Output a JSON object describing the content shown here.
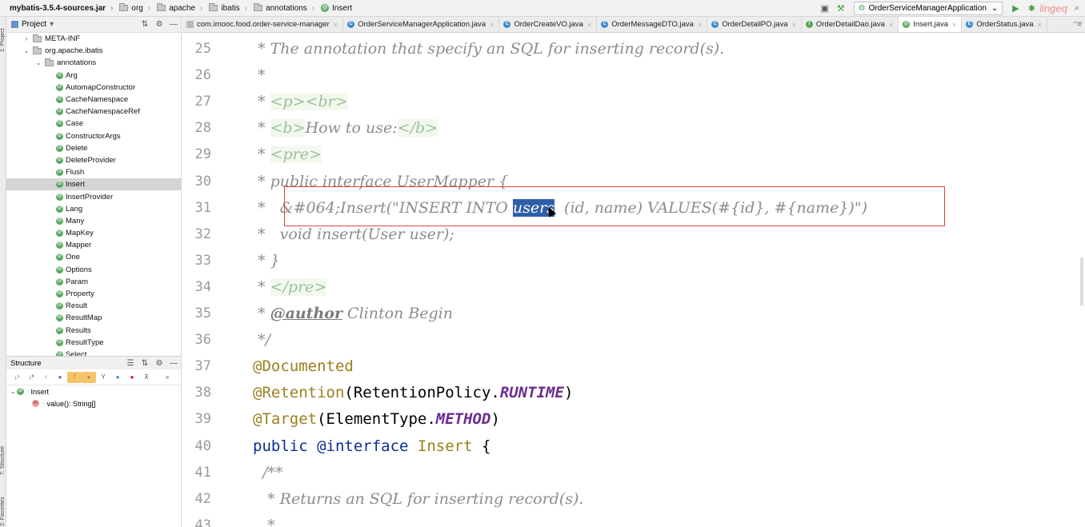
{
  "navbar": {
    "breadcrumbs": [
      {
        "label": "mybatis-3.5.4-sources.jar",
        "icon": "jar-icon"
      },
      {
        "label": "org",
        "icon": "folder-icon"
      },
      {
        "label": "apache",
        "icon": "folder-icon"
      },
      {
        "label": "ibatis",
        "icon": "folder-icon"
      },
      {
        "label": "annotations",
        "icon": "folder-icon"
      },
      {
        "label": "Insert",
        "icon": "annotation-icon"
      }
    ],
    "run_config": "OrderServiceManagerApplication",
    "watermark": "lingeq"
  },
  "project_panel": {
    "title": "Project",
    "tree": [
      {
        "label": "META-INF",
        "indent": 2,
        "arrow": "›",
        "type": "folder"
      },
      {
        "label": "org.apache.ibatis",
        "indent": 2,
        "arrow": "⌄",
        "type": "folder"
      },
      {
        "label": "annotations",
        "indent": 3,
        "arrow": "⌄",
        "type": "folder"
      },
      {
        "label": "Arg",
        "indent": 4,
        "type": "annotation"
      },
      {
        "label": "AutomapConstructor",
        "indent": 4,
        "type": "annotation"
      },
      {
        "label": "CacheNamespace",
        "indent": 4,
        "type": "annotation"
      },
      {
        "label": "CacheNamespaceRef",
        "indent": 4,
        "type": "annotation"
      },
      {
        "label": "Case",
        "indent": 4,
        "type": "annotation"
      },
      {
        "label": "ConstructorArgs",
        "indent": 4,
        "type": "annotation"
      },
      {
        "label": "Delete",
        "indent": 4,
        "type": "annotation"
      },
      {
        "label": "DeleteProvider",
        "indent": 4,
        "type": "annotation"
      },
      {
        "label": "Flush",
        "indent": 4,
        "type": "annotation"
      },
      {
        "label": "Insert",
        "indent": 4,
        "type": "annotation",
        "selected": true
      },
      {
        "label": "InsertProvider",
        "indent": 4,
        "type": "annotation"
      },
      {
        "label": "Lang",
        "indent": 4,
        "type": "annotation"
      },
      {
        "label": "Many",
        "indent": 4,
        "type": "annotation"
      },
      {
        "label": "MapKey",
        "indent": 4,
        "type": "annotation"
      },
      {
        "label": "Mapper",
        "indent": 4,
        "type": "annotation"
      },
      {
        "label": "One",
        "indent": 4,
        "type": "annotation"
      },
      {
        "label": "Options",
        "indent": 4,
        "type": "annotation"
      },
      {
        "label": "Param",
        "indent": 4,
        "type": "annotation"
      },
      {
        "label": "Property",
        "indent": 4,
        "type": "annotation"
      },
      {
        "label": "Result",
        "indent": 4,
        "type": "annotation"
      },
      {
        "label": "ResultMap",
        "indent": 4,
        "type": "annotation"
      },
      {
        "label": "Results",
        "indent": 4,
        "type": "annotation"
      },
      {
        "label": "ResultType",
        "indent": 4,
        "type": "annotation"
      },
      {
        "label": "Select",
        "indent": 4,
        "type": "annotation"
      }
    ]
  },
  "structure_panel": {
    "title": "Structure",
    "items": [
      {
        "label": "Insert",
        "kind": "annotation",
        "arrow": "⌄"
      },
      {
        "label": "value(): String[]",
        "kind": "method"
      }
    ]
  },
  "left_strip": {
    "labels": [
      "1: Project",
      "7: Structure",
      "2: Favorites"
    ]
  },
  "tabs": [
    {
      "label": "com.imooc.food.order-service-manager",
      "icon": "pkg"
    },
    {
      "label": "OrderServiceManagerApplication.java",
      "icon": "c"
    },
    {
      "label": "OrderCreateVO.java",
      "icon": "c"
    },
    {
      "label": "OrderMessageDTO.java",
      "icon": "c"
    },
    {
      "label": "OrderDetailPO.java",
      "icon": "c"
    },
    {
      "label": "OrderDetailDao.java",
      "icon": "i"
    },
    {
      "label": "Insert.java",
      "icon": "a",
      "active": true
    },
    {
      "label": "OrderStatus.java",
      "icon": "e"
    }
  ],
  "editor": {
    "lines": [
      {
        "n": "25",
        "html_parts": [
          {
            "t": " * The annotation that specify an SQL for inserting record(s).",
            "c": "cm"
          }
        ]
      },
      {
        "n": "26",
        "html_parts": [
          {
            "t": " *",
            "c": "cm"
          }
        ]
      },
      {
        "n": "27",
        "html_parts": [
          {
            "t": " * ",
            "c": "cm"
          },
          {
            "t": "<p><br>",
            "c": "cm cm-tag"
          }
        ]
      },
      {
        "n": "28",
        "html_parts": [
          {
            "t": " * ",
            "c": "cm"
          },
          {
            "t": "<b>",
            "c": "cm cm-tag"
          },
          {
            "t": "How to use:",
            "c": "cm"
          },
          {
            "t": "</b>",
            "c": "cm cm-tag"
          }
        ]
      },
      {
        "n": "29",
        "html_parts": [
          {
            "t": " * ",
            "c": "cm"
          },
          {
            "t": "<pre>",
            "c": "cm cm-tag"
          }
        ]
      },
      {
        "n": "30",
        "html_parts": [
          {
            "t": " * public interface UserMapper {",
            "c": "cm"
          }
        ]
      },
      {
        "n": "31",
        "html_parts": [
          {
            "t": " *   &#064;Insert(\"INSERT INTO ",
            "c": "cm"
          },
          {
            "t": "users",
            "c": "cm highlight"
          },
          {
            "t": "  (id, name) VALUES(#{id}, #{name})\")",
            "c": "cm"
          }
        ]
      },
      {
        "n": "32",
        "html_parts": [
          {
            "t": " *   void insert(User user);",
            "c": "cm"
          }
        ]
      },
      {
        "n": "33",
        "html_parts": [
          {
            "t": " * }",
            "c": "cm"
          }
        ]
      },
      {
        "n": "34",
        "html_parts": [
          {
            "t": " * ",
            "c": "cm"
          },
          {
            "t": "</pre>",
            "c": "cm cm-tag"
          }
        ]
      },
      {
        "n": "35",
        "html_parts": [
          {
            "t": " * ",
            "c": "cm"
          },
          {
            "t": "@author",
            "c": "cm cm-doc"
          },
          {
            "t": " Clinton Begin",
            "c": "cm"
          }
        ]
      },
      {
        "n": "36",
        "html_parts": [
          {
            "t": " */",
            "c": "cm"
          }
        ]
      },
      {
        "n": "37",
        "html_parts": [
          {
            "t": "@Documented",
            "c": "ann"
          }
        ]
      },
      {
        "n": "38",
        "html_parts": [
          {
            "t": "@Retention",
            "c": "ann"
          },
          {
            "t": "(RetentionPolicy.",
            "c": ""
          },
          {
            "t": "RUNTIME",
            "c": "const"
          },
          {
            "t": ")",
            "c": ""
          }
        ]
      },
      {
        "n": "39",
        "html_parts": [
          {
            "t": "@Target",
            "c": "ann"
          },
          {
            "t": "(ElementType.",
            "c": ""
          },
          {
            "t": "METHOD",
            "c": "const"
          },
          {
            "t": ")",
            "c": ""
          }
        ]
      },
      {
        "n": "40",
        "html_parts": [
          {
            "t": "public @interface ",
            "c": "kw"
          },
          {
            "t": "Insert",
            "c": "ann"
          },
          {
            "t": " {",
            "c": ""
          }
        ]
      },
      {
        "n": "41",
        "html_parts": [
          {
            "t": "  /**",
            "c": "cm"
          }
        ]
      },
      {
        "n": "42",
        "html_parts": [
          {
            "t": "   * Returns an SQL for inserting record(s).",
            "c": "cm"
          }
        ]
      },
      {
        "n": "43",
        "html_parts": [
          {
            "t": "   *",
            "c": "cm"
          }
        ]
      }
    ]
  }
}
